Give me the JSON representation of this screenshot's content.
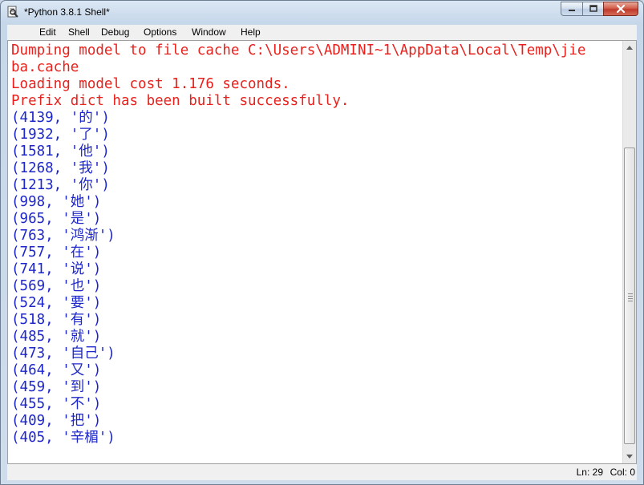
{
  "window": {
    "title": "*Python 3.8.1 Shell*",
    "buttons": {
      "minimize": "minimize",
      "maximize": "maximize",
      "close": "close"
    }
  },
  "menubar": {
    "items": [
      "Edit",
      "Shell",
      "Debug",
      "Options",
      "Window",
      "Help"
    ]
  },
  "shell": {
    "lines": [
      {
        "text": "Dumping model to file cache C:\\Users\\ADMINI~1\\AppData\\Local\\Temp\\jie",
        "kind": "stderr"
      },
      {
        "text": "ba.cache",
        "kind": "stderr"
      },
      {
        "text": "Loading model cost 1.176 seconds.",
        "kind": "stderr"
      },
      {
        "text": "Prefix dict has been built successfully.",
        "kind": "stderr"
      },
      {
        "text": "(4139, '的')",
        "kind": "stdout"
      },
      {
        "text": "(1932, '了')",
        "kind": "stdout"
      },
      {
        "text": "(1581, '他')",
        "kind": "stdout"
      },
      {
        "text": "(1268, '我')",
        "kind": "stdout"
      },
      {
        "text": "(1213, '你')",
        "kind": "stdout"
      },
      {
        "text": "(998, '她')",
        "kind": "stdout"
      },
      {
        "text": "(965, '是')",
        "kind": "stdout"
      },
      {
        "text": "(763, '鸿渐')",
        "kind": "stdout"
      },
      {
        "text": "(757, '在')",
        "kind": "stdout"
      },
      {
        "text": "(741, '说')",
        "kind": "stdout"
      },
      {
        "text": "(569, '也')",
        "kind": "stdout"
      },
      {
        "text": "(524, '要')",
        "kind": "stdout"
      },
      {
        "text": "(518, '有')",
        "kind": "stdout"
      },
      {
        "text": "(485, '就')",
        "kind": "stdout"
      },
      {
        "text": "(473, '自己')",
        "kind": "stdout"
      },
      {
        "text": "(464, '又')",
        "kind": "stdout"
      },
      {
        "text": "(459, '到')",
        "kind": "stdout"
      },
      {
        "text": "(455, '不')",
        "kind": "stdout"
      },
      {
        "text": "(409, '把')",
        "kind": "stdout"
      },
      {
        "text": "(405, '辛楣')",
        "kind": "stdout"
      }
    ],
    "colors": {
      "stderr": "#e8211c",
      "stdout": "#1d26c9"
    }
  },
  "status": {
    "ln": "Ln: 29",
    "col": "Col: 0"
  }
}
